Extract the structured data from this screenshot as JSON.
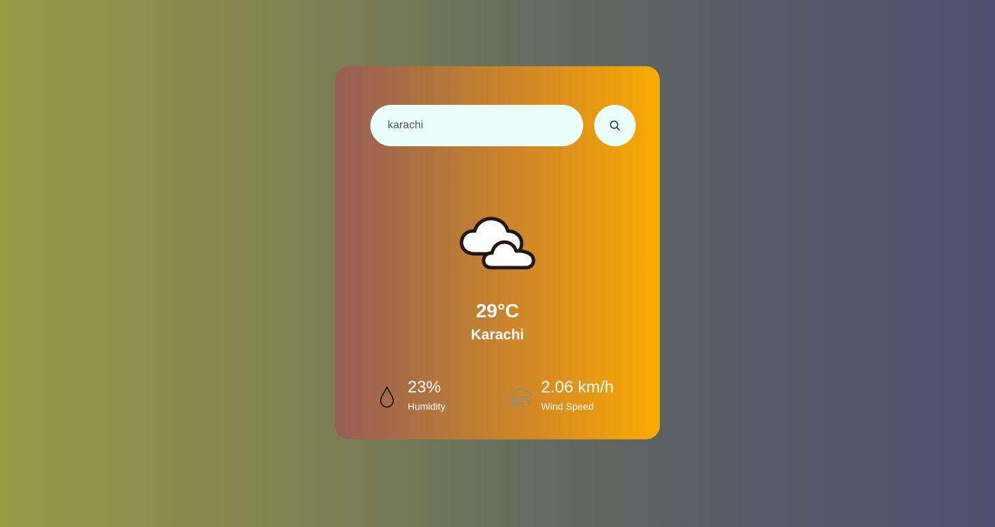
{
  "search": {
    "value": "karachi"
  },
  "icons": {
    "search": "search-icon",
    "weather": "clouds-icon",
    "humidity": "droplet-icon",
    "wind": "wind-icon"
  },
  "weather": {
    "temperature": "29°C",
    "city": "Karachi",
    "condition": "Clouds"
  },
  "details": {
    "humidity_value": "23%",
    "humidity_label": "Humidity",
    "wind_value": "2.06 km/h",
    "wind_label": "Wind Speed"
  },
  "colors": {
    "card_start": "#965d58",
    "card_end": "#f9ab02",
    "input_bg": "#ebfffc",
    "text": "#ffffff"
  }
}
